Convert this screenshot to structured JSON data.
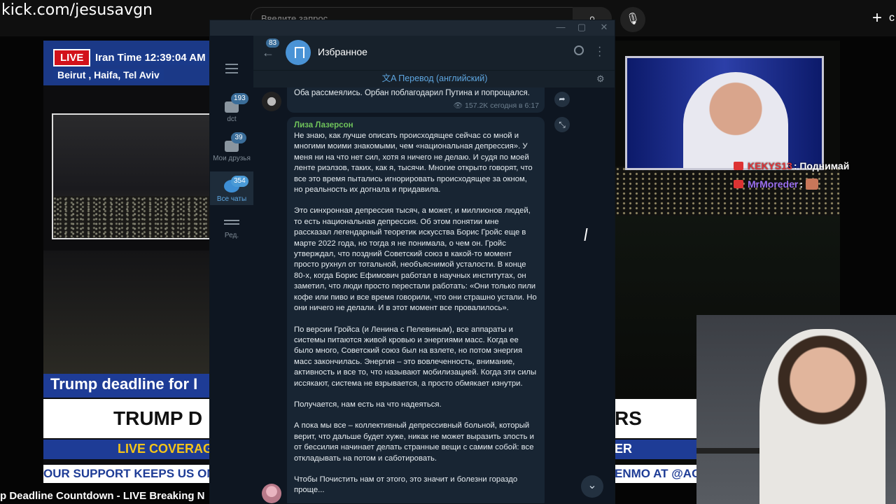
{
  "stream": {
    "url": "kick.com/jesusavgn",
    "search_placeholder": "Введите запрос",
    "bottom_title": "p Deadline Countdown - LIVE Breaking N"
  },
  "news": {
    "live": "LIVE",
    "iran_time": "Iran Time 12:39:04 AM",
    "cities": "Beirut , Haifa, Tel Aviv",
    "ticker1": "Trump deadline for I",
    "ticker2": "TRUMP D",
    "ticker3": "LIVE COVERAG",
    "ticker4": "OUR SUPPORT KEEPS US ON T",
    "right_ticker2": "RS",
    "right_ticker3": "ER",
    "right_ticker4": "ENMO AT @AGE"
  },
  "chat": [
    {
      "user": "KEKYS13",
      "message": ": Поднимай"
    },
    {
      "user": "MrMoreder",
      "message": ":"
    }
  ],
  "telegram": {
    "folders": [
      {
        "label": "dct",
        "badge": "193",
        "icon": "folder-icon"
      },
      {
        "label": "Мои друзья",
        "badge": "39",
        "icon": "folder-icon"
      },
      {
        "label": "Все чаты",
        "badge": "354",
        "icon": "chats-icon",
        "active": true
      },
      {
        "label": "Ред.",
        "badge": "",
        "icon": "edit-folders-icon"
      }
    ],
    "back_badge": "83",
    "chat_title": "Избранное",
    "translate_label": "Перевод (английский)",
    "prev_message": {
      "text": "Оба рассмеялись. Орбан поблагодарил Путина и попрощался.",
      "views": "157.2K",
      "time": "сегодня в 6:17"
    },
    "message": {
      "author": "Лиза Лазерсон",
      "paragraphs": [
        "Не знаю, как лучше описать происходящее сейчас со мной и многими моими знакомыми, чем «национальная депрессия». У меня ни на что нет сил, хотя я ничего не делаю. И судя по моей ленте риэлзов, таких, как я, тысячи. Многие открыто говорят, что все это время пытались игнорировать происходящее за окном, но реальность их догнала и придавила.",
        "Это синхронная депрессия тысяч, а может, и миллионов людей, то есть национальная депрессия. Об этом понятии мне рассказал легендарный теоретик искусства Борис Гройс еще в марте 2022 года, но тогда я не понимала, о чем он. Гройс утверждал, что поздний Советский союз в какой-то момент просто рухнул от тотальной, необъяснимой усталости. В конце 80-х, когда Борис Ефимович работал в научных институтах, он заметил, что люди просто перестали работать: «Они только пили кофе или пиво и все время говорили, что они страшно устали. Но они ничего не делали. И в этот момент все провалилось».",
        "По версии Гройса (и Ленина с Пелевиным), все аппараты и системы питаются живой кровью и энергиями масс. Когда ее было много, Советский союз был на взлете, но потом энергия масс закончилась. Энергия – это вовлеченность, внимание, активность и все то, что называют мобилизацией. Когда эти силы иссякают, система не взрывается, а просто обмякает изнутри.",
        "Получается, нам есть на что надеяться.",
        "А пока мы все – коллективный депрессивный больной, который верит, что дальше будет хуже, никак не может выразить злость и от бессилия начинает делать странные вещи с самим собой: все откладывать на потом и саботировать.",
        "Чтобы Почистить нам от этого, это значит и болезни гораздо проще..."
      ]
    }
  }
}
